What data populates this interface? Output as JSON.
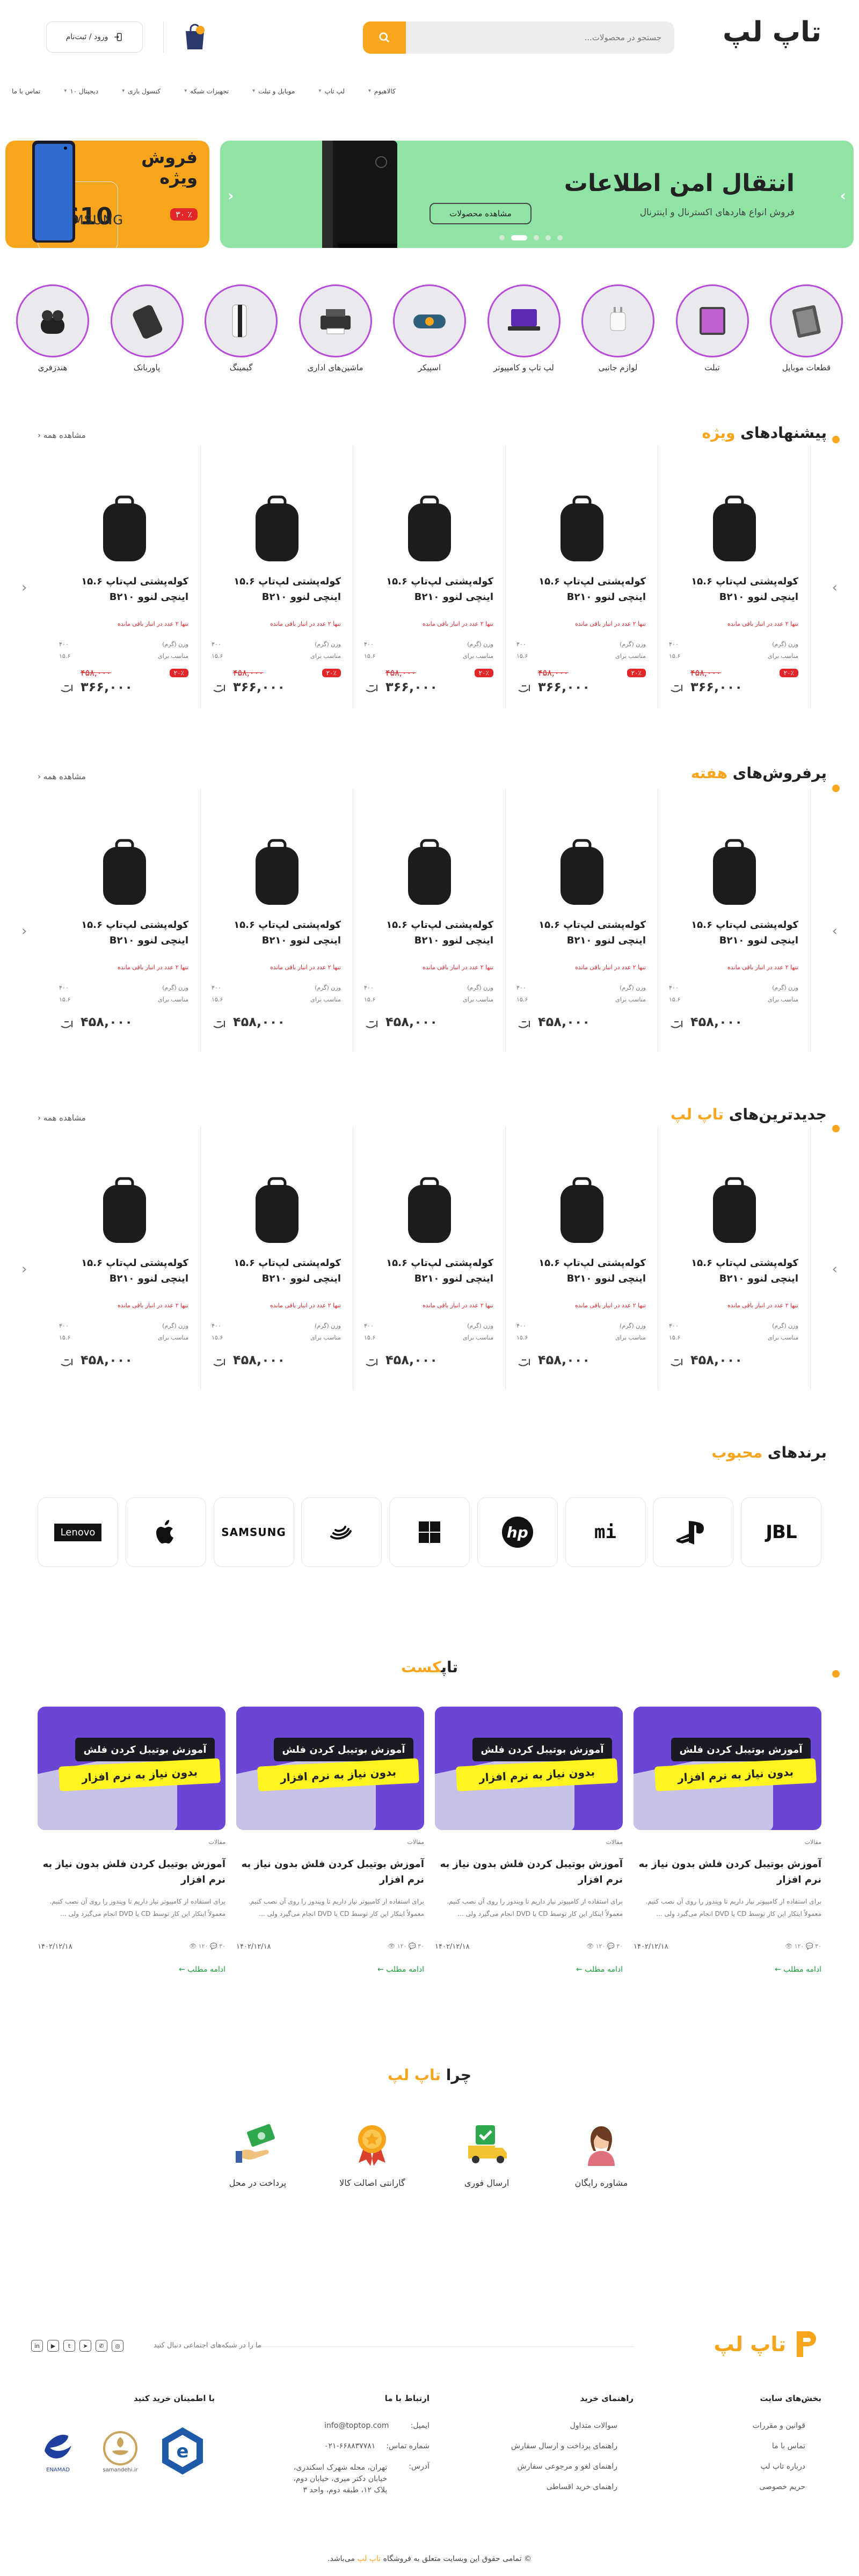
{
  "header": {
    "logo": "تاپ لپ",
    "search_placeholder": "جستجو در محصولات...",
    "login_label": "ورود / ثبت‌نام"
  },
  "nav": [
    {
      "label": "کالاهیوم"
    },
    {
      "label": "لپ تاپ"
    },
    {
      "label": "موبایل و تبلت"
    },
    {
      "label": "تجهیزات شبکه"
    },
    {
      "label": "کنسول بازی"
    },
    {
      "label": "دیجیتال ۱۰"
    },
    {
      "label": "تماس با ما"
    }
  ],
  "banner": {
    "title": "انتقال امن اطلاعات",
    "subtitle": "فروش انواع هاردهای اکسترنال و اینترنال",
    "cta": "مشاهده محصولات"
  },
  "promo": {
    "title_1": "فروش",
    "title_2": "ویژه",
    "discount": "٪ ۳۰",
    "model": "S10+",
    "brand": "SAMSUNG"
  },
  "categories": [
    {
      "label": "هندزفری"
    },
    {
      "label": "پاوربانک"
    },
    {
      "label": "گیمینگ"
    },
    {
      "label": "ماشین‌های اداری"
    },
    {
      "label": "اسپیکر"
    },
    {
      "label": "لپ تاپ و کامپیوتر"
    },
    {
      "label": "لوازم جانبی"
    },
    {
      "label": "تبلت"
    },
    {
      "label": "قطعات موبایل"
    }
  ],
  "sections": {
    "special": {
      "title_plain": "پیشنهادهای ",
      "title_accent": "ویژه",
      "more": "مشاهده همه"
    },
    "bestsell": {
      "title_plain": "پرفروش‌های ",
      "title_accent": "هفته",
      "more": "مشاهده همه"
    },
    "newest": {
      "title_plain": "جدیدترین‌های ",
      "title_accent": "تاپ لپ",
      "more": "مشاهده همه"
    },
    "brands": {
      "title_plain": "برندهای ",
      "title_accent": "محبوب"
    },
    "podcast": {
      "title_plain": "تاپ",
      "title_accent": "کست"
    },
    "why": {
      "title_plain": "چرا ",
      "title_accent": "تاپ لپ"
    }
  },
  "product": {
    "title": "کوله‌پشتی لپ‌تاپ ۱۵.۶ اینچی لنوو B۲۱۰",
    "warning": "تنها ۲ عدد در انبار باقی مانده",
    "spec_1_label": "وزن (گرم)",
    "spec_1_value": "۴۰۰",
    "spec_2_label": "مناسب برای",
    "spec_2_value": "لپ‌تاپ ۱۵.۶ اینچ",
    "old_price": "۴۵۸,۰۰۰",
    "discount": "۲۰٪",
    "special_price": "۳۶۶,۰۰۰",
    "price": "۴۵۸,۰۰۰"
  },
  "brands": [
    {
      "label": "Lenovo"
    },
    {
      "label": "Apple"
    },
    {
      "label": "SAMSUNG"
    },
    {
      "label": "Seagate"
    },
    {
      "label": "Windows"
    },
    {
      "label": "hp"
    },
    {
      "label": "mi"
    },
    {
      "label": "PlayStation"
    },
    {
      "label": "JBL"
    }
  ],
  "post": {
    "banner_1": "آموزش بوتیبل کردن فلش",
    "banner_2": "بدون نیاز به نرم افزار",
    "category": "مقالات",
    "title": "آموزش بوتیبل کردن فلش بدون نیاز به نرم افزار",
    "excerpt": "برای استفاده از کامپیوتر نیاز داریم تا ویندوز را روی آن نصب کنیم. معمولاً اینکار این کار توسط CD یا DVD انجام می‌گیرد ولی ...",
    "stats": "۳۰ 💬 ۱۲۰ 👁",
    "date": "۱۴۰۲/۱۲/۱۸",
    "read_more": "ادامه مطلب"
  },
  "why": [
    {
      "label": "پرداخت در محل"
    },
    {
      "label": "گارانتی اصالت کالا"
    },
    {
      "label": "ارسال فوری"
    },
    {
      "label": "مشاوره رایگان"
    }
  ],
  "footer": {
    "logo": "تاپ لپ",
    "social_title": "ما را در شبکه‌های اجتماعی دنبال کنید",
    "col1_title": "بخش‌های سایت",
    "col1_items": [
      "قوانین و مقررات",
      "تماس با ما",
      "درباره تاپ لپ",
      "حریم خصوصی"
    ],
    "col2_title": "راهنمای خرید",
    "col2_items": [
      "سوالات متداول",
      "راهنمای پرداخت و ارسال سفارش",
      "راهنمای لغو و مرجوعی سفارش",
      "راهنمای خرید اقساطی"
    ],
    "col3_title": "ارتباط با ما",
    "email_label": "ایمیل:",
    "email": "info@toptop.com",
    "phone_label": "شماره تماس:",
    "phone": "۰۲۱-۶۶۸۸۳۷۷۸۱",
    "address_label": "آدرس:",
    "address": "تهران، محله شهرک اسکندری، خیابان دکتر میری، خیابان دوم، پلاک ۱۲، طبقه دوم، واحد ۳",
    "col4_title": "با اطمینان خرید کنید",
    "trust_1": "ENAMAD",
    "trust_2": "samandehi.ir",
    "trust_3": "e",
    "copyright_pre": "تمامی حقوق این وبسایت متعلق به فروشگاه ",
    "copyright_brand": "تاپ لپ",
    "copyright_post": " می‌باشد."
  },
  "colors": {
    "accent": "#f7a51c",
    "banner_green": "#8ee3a5",
    "danger": "#e3262a",
    "purple": "#6a45d6"
  }
}
